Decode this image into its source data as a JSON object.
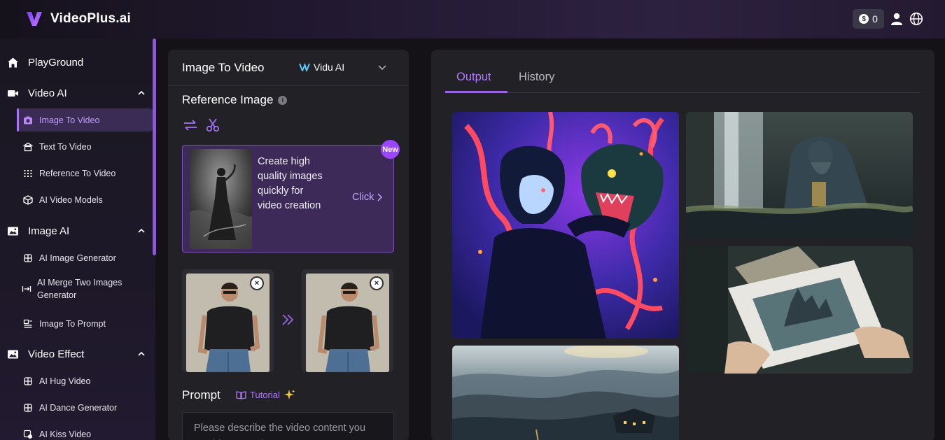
{
  "header": {
    "brand": "VideoPlus.ai",
    "credits_count": "0",
    "credits_icon": "$"
  },
  "sidebar": {
    "groups": [
      {
        "label": "PlayGround",
        "icon": "home-icon"
      },
      {
        "label": "Video AI",
        "icon": "video-camera-icon",
        "items": [
          {
            "label": "Image To Video",
            "icon": "camera-icon",
            "active": true
          },
          {
            "label": "Text To Video",
            "icon": "text-icon"
          },
          {
            "label": "Reference To Video",
            "icon": "grid-icon"
          },
          {
            "label": "AI Video Models",
            "icon": "cube-icon"
          }
        ]
      },
      {
        "label": "Image AI",
        "icon": "image-icon",
        "items": [
          {
            "label": "AI Image Generator",
            "icon": "sparkle-icon"
          },
          {
            "label": "AI Merge Two Images Generator",
            "icon": "merge-icon"
          },
          {
            "label": "Image To Prompt",
            "icon": "doc-icon"
          }
        ]
      },
      {
        "label": "Video Effect",
        "icon": "image-icon",
        "items": [
          {
            "label": "AI Hug Video",
            "icon": "sparkle-icon"
          },
          {
            "label": "AI Dance Generator",
            "icon": "sparkle-icon"
          },
          {
            "label": "AI Kiss Video",
            "icon": "kiss-icon"
          }
        ]
      }
    ]
  },
  "panel": {
    "title": "Image To Video",
    "model": "Vidu AI",
    "reference_title": "Reference Image",
    "info_glyph": "i",
    "promo": {
      "text": "Create high quality images quickly for video creation",
      "click": "Click",
      "badge": "New"
    },
    "remove_glyph": "×",
    "prompt_title": "Prompt",
    "tutorial": "Tutorial",
    "prompt_placeholder": "Please describe the video content you want to generate"
  },
  "output": {
    "tabs": [
      {
        "label": "Output",
        "active": true
      },
      {
        "label": "History",
        "active": false
      }
    ]
  },
  "colors": {
    "accent": "#a47af0",
    "accent_bright": "#9b46ff",
    "bg": "#141217",
    "panel": "#222126"
  }
}
